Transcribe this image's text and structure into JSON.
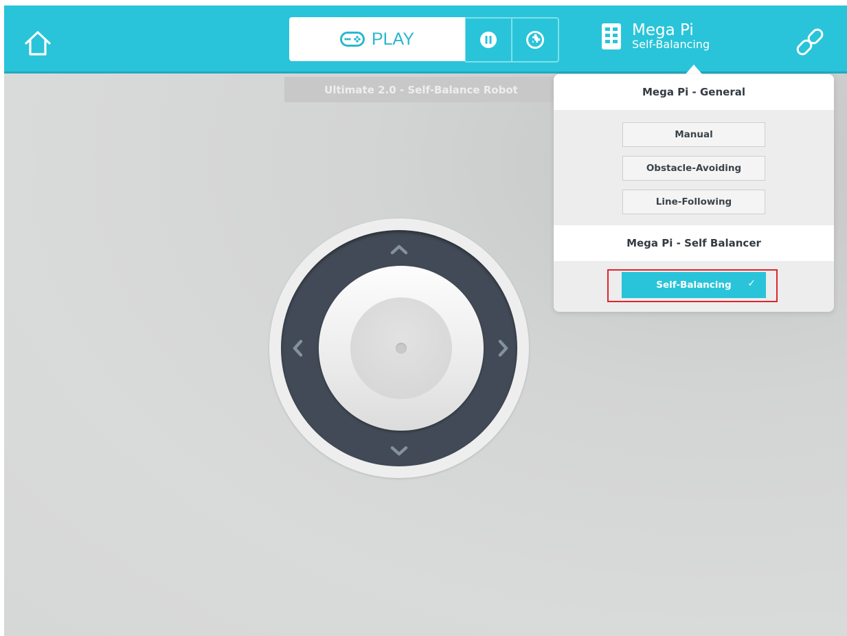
{
  "toolbar": {
    "play_label": "PLAY",
    "device_name": "Mega Pi",
    "device_mode": "Self-Balancing",
    "home_icon": "home-icon",
    "gamepad_icon": "gamepad-icon",
    "pause_icon": "pause-icon",
    "puzzle_icon": "puzzle-icon",
    "board_icon": "board-icon",
    "link_icon": "link-icon"
  },
  "project": {
    "title": "Ultimate 2.0 - Self-Balance Robot"
  },
  "joystick": {
    "up_icon": "chevron-up-icon",
    "down_icon": "chevron-down-icon",
    "left_icon": "chevron-left-icon",
    "right_icon": "chevron-right-icon"
  },
  "mode_menu": {
    "sections": [
      {
        "header": "Mega Pi - General",
        "options": [
          "Manual",
          "Obstacle-Avoiding",
          "Line-Following"
        ]
      },
      {
        "header": "Mega Pi - Self Balancer",
        "options": [
          "Self-Balancing"
        ]
      }
    ],
    "selected": "Self-Balancing",
    "check_glyph": "✓"
  },
  "colors": {
    "accent": "#29c4d9",
    "dark_ring": "#414a56",
    "highlight": "#e0232b"
  }
}
